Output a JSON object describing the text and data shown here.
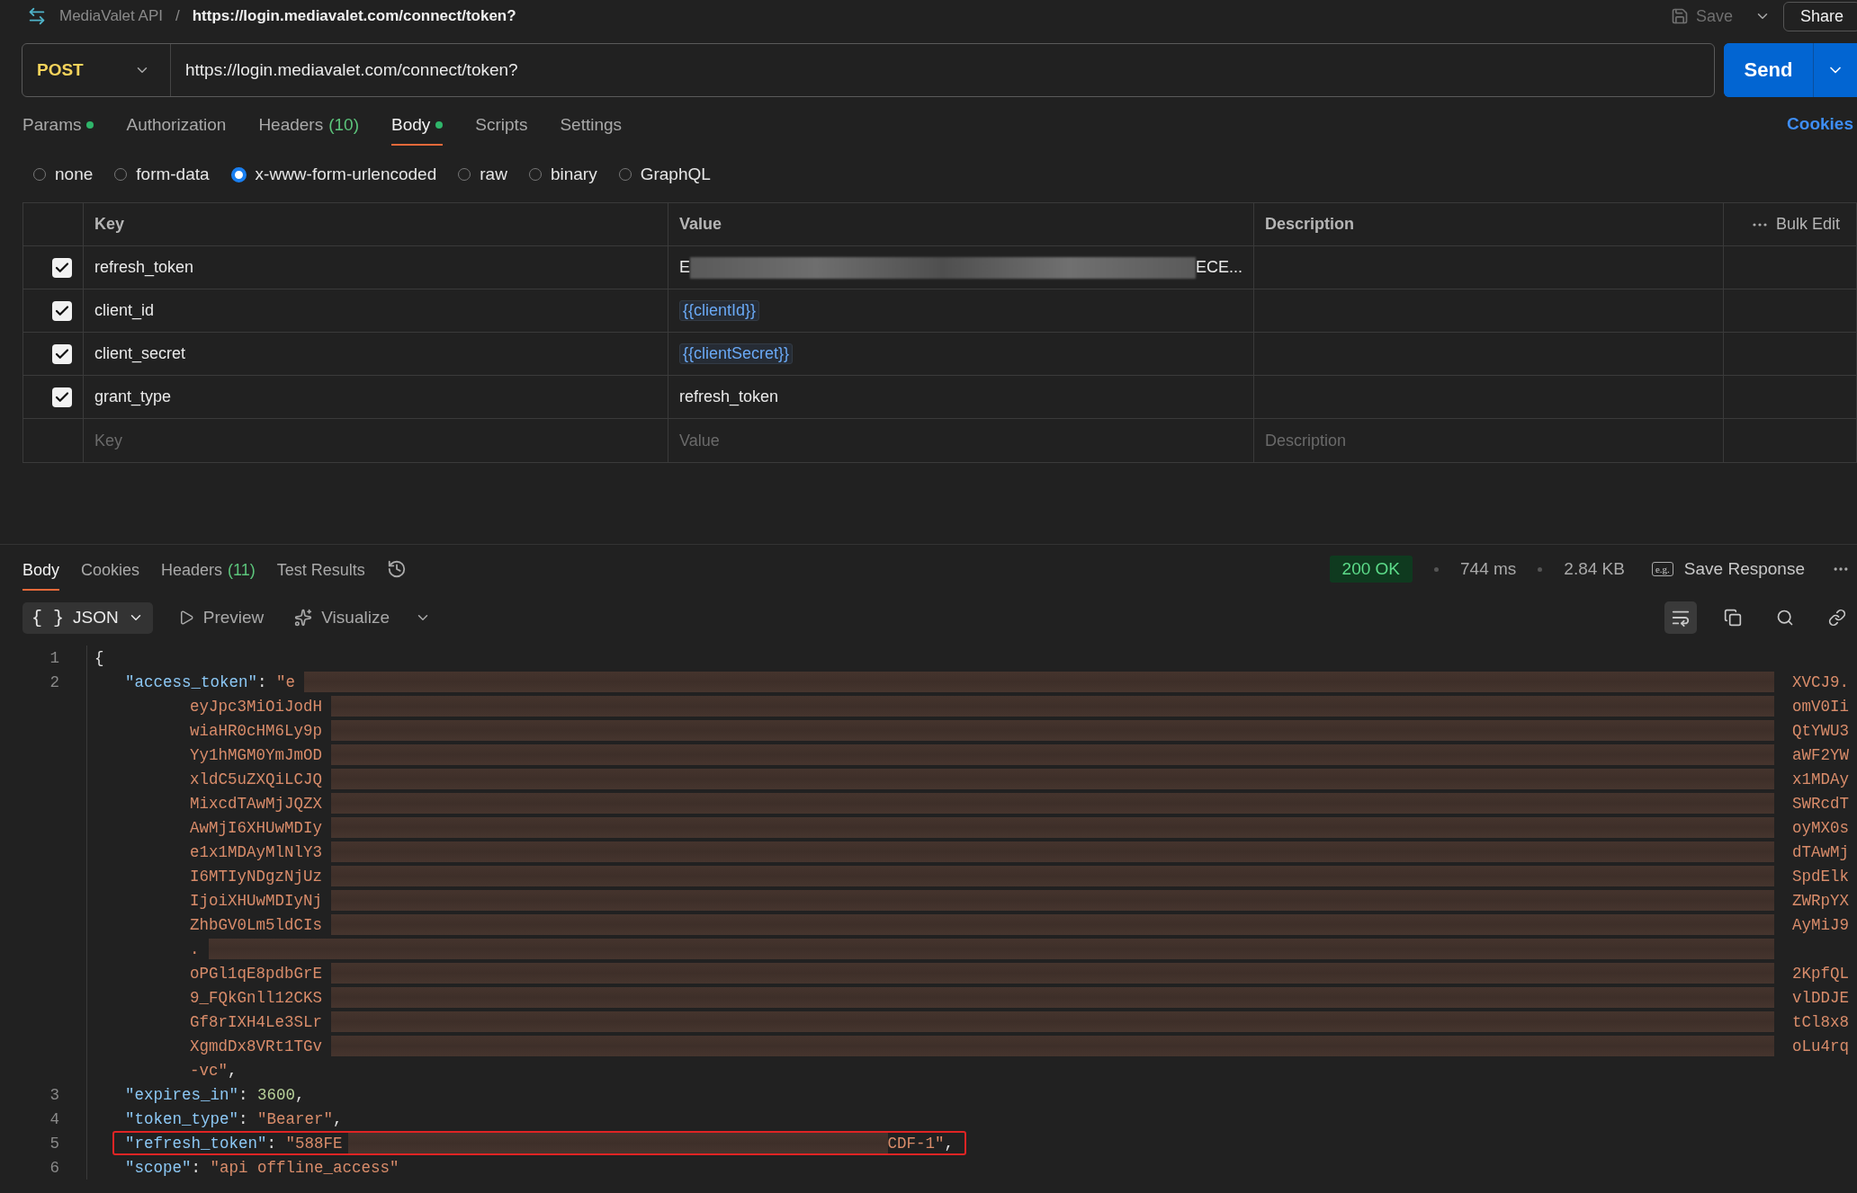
{
  "header": {
    "collection": "MediaValet API",
    "separator": "/",
    "request_name": "https://login.mediavalet.com/connect/token?",
    "save": "Save",
    "share": "Share"
  },
  "request": {
    "method": "POST",
    "url": "https://login.mediavalet.com/connect/token?",
    "send": "Send"
  },
  "request_tabs": [
    {
      "label": "Params",
      "dot": true,
      "selected": false
    },
    {
      "label": "Authorization",
      "dot": false,
      "selected": false
    },
    {
      "label": "Headers",
      "count": "(10)",
      "dot": false,
      "selected": false
    },
    {
      "label": "Body",
      "dot": true,
      "selected": true
    },
    {
      "label": "Scripts",
      "dot": false,
      "selected": false
    },
    {
      "label": "Settings",
      "dot": false,
      "selected": false
    }
  ],
  "cookies_link": "Cookies",
  "body_types": [
    {
      "label": "none",
      "selected": false
    },
    {
      "label": "form-data",
      "selected": false
    },
    {
      "label": "x-www-form-urlencoded",
      "selected": true
    },
    {
      "label": "raw",
      "selected": false
    },
    {
      "label": "binary",
      "selected": false
    },
    {
      "label": "GraphQL",
      "selected": false
    }
  ],
  "params_table": {
    "columns": [
      "Key",
      "Value",
      "Description"
    ],
    "bulk_edit": "Bulk Edit",
    "rows": [
      {
        "checked": true,
        "key": "refresh_token",
        "value": {
          "kind": "redacted",
          "start": "E",
          "end": "ECE..."
        }
      },
      {
        "checked": true,
        "key": "client_id",
        "value": {
          "kind": "variable",
          "text": "{{clientId}}"
        }
      },
      {
        "checked": true,
        "key": "client_secret",
        "value": {
          "kind": "variable",
          "text": "{{clientSecret}}"
        }
      },
      {
        "checked": true,
        "key": "grant_type",
        "value": {
          "kind": "text",
          "text": "refresh_token"
        }
      }
    ],
    "placeholders": {
      "key": "Key",
      "value": "Value",
      "description": "Description"
    }
  },
  "response": {
    "tabs": [
      {
        "label": "Body",
        "selected": true
      },
      {
        "label": "Cookies",
        "selected": false
      },
      {
        "label": "Headers",
        "count": "(11)",
        "selected": false
      },
      {
        "label": "Test Results",
        "selected": false
      }
    ],
    "status": "200 OK",
    "time": "744 ms",
    "size": "2.84 KB",
    "save_icon_text": "e.g.",
    "save_response": "Save Response",
    "format": "JSON",
    "format_icon": "{ }",
    "preview": "Preview",
    "visualize": "Visualize",
    "wrap_selected": true,
    "lines": [
      {
        "number": "1",
        "kind": "brace",
        "tokens": [
          {
            "kind": "punct",
            "text": "{"
          }
        ]
      },
      {
        "number": "2",
        "kind": "property",
        "redacted": true,
        "tokens": [
          {
            "kind": "key",
            "text": "\"access_token\""
          },
          {
            "kind": "punct",
            "text": ": "
          },
          {
            "kind": "string",
            "text": "\"e"
          }
        ],
        "tail": "XVCJ9."
      },
      {
        "kind": "wrap",
        "redacted": true,
        "tokens": [
          {
            "kind": "string",
            "text": "eyJpc3MiOiJodH"
          }
        ],
        "tail": "omV0Ii"
      },
      {
        "kind": "wrap",
        "redacted": true,
        "tokens": [
          {
            "kind": "string",
            "text": "wiaHR0cHM6Ly9p"
          }
        ],
        "tail": "QtYWU3"
      },
      {
        "kind": "wrap",
        "redacted": true,
        "tokens": [
          {
            "kind": "string",
            "text": "Yy1hMGM0YmJmOD"
          }
        ],
        "tail": "aWF2YW"
      },
      {
        "kind": "wrap",
        "redacted": true,
        "tokens": [
          {
            "kind": "string",
            "text": "xldC5uZXQiLCJQ"
          }
        ],
        "tail": "x1MDAy"
      },
      {
        "kind": "wrap",
        "redacted": true,
        "tokens": [
          {
            "kind": "string",
            "text": "MixcdTAwMjJQZX"
          }
        ],
        "tail": "SWRcdT"
      },
      {
        "kind": "wrap",
        "redacted": true,
        "tokens": [
          {
            "kind": "string",
            "text": "AwMjI6XHUwMDIy"
          }
        ],
        "tail": "oyMX0s"
      },
      {
        "kind": "wrap",
        "redacted": true,
        "tokens": [
          {
            "kind": "string",
            "text": "e1x1MDAyMlNlY3"
          }
        ],
        "tail": "dTAwMj"
      },
      {
        "kind": "wrap",
        "redacted": true,
        "tokens": [
          {
            "kind": "string",
            "text": "I6MTIyNDgzNjUz"
          }
        ],
        "tail": "SpdElk"
      },
      {
        "kind": "wrap",
        "redacted": true,
        "tokens": [
          {
            "kind": "string",
            "text": "IjoiXHUwMDIyNj"
          }
        ],
        "tail": "ZWRpYX"
      },
      {
        "kind": "wrap",
        "redacted": true,
        "tokens": [
          {
            "kind": "string",
            "text": "ZhbGV0Lm5ldCIs"
          }
        ],
        "tail": "AyMiJ9"
      },
      {
        "kind": "wrap",
        "redacted": true,
        "tokens": [
          {
            "kind": "string",
            "text": "."
          }
        ]
      },
      {
        "kind": "wrap",
        "redacted": true,
        "tokens": [
          {
            "kind": "string",
            "text": "oPGl1qE8pdbGrE"
          }
        ],
        "tail": "2KpfQL"
      },
      {
        "kind": "wrap",
        "redacted": true,
        "tokens": [
          {
            "kind": "string",
            "text": "9_FQkGnll12CKS"
          }
        ],
        "tail": "vlDDJE"
      },
      {
        "kind": "wrap",
        "redacted": true,
        "tokens": [
          {
            "kind": "string",
            "text": "Gf8rIXH4Le3SLr"
          }
        ],
        "tail": "tCl8x8"
      },
      {
        "kind": "wrap",
        "redacted": true,
        "tokens": [
          {
            "kind": "string",
            "text": "XgmdDx8VRt1TGv"
          }
        ],
        "tail": "oLu4rq"
      },
      {
        "kind": "wrap",
        "tokens": [
          {
            "kind": "string",
            "text": "-vc\""
          },
          {
            "kind": "punct",
            "text": ","
          }
        ]
      },
      {
        "number": "3",
        "kind": "property",
        "tokens": [
          {
            "kind": "key",
            "text": "\"expires_in\""
          },
          {
            "kind": "punct",
            "text": ": "
          },
          {
            "kind": "number",
            "text": "3600"
          },
          {
            "kind": "punct",
            "text": ","
          }
        ]
      },
      {
        "number": "4",
        "kind": "property",
        "tokens": [
          {
            "kind": "key",
            "text": "\"token_type\""
          },
          {
            "kind": "punct",
            "text": ": "
          },
          {
            "kind": "string",
            "text": "\"Bearer\""
          },
          {
            "kind": "punct",
            "text": ","
          }
        ]
      },
      {
        "number": "5",
        "kind": "property",
        "outlined": true,
        "redacted": true,
        "tokens": [
          {
            "kind": "key",
            "text": "\"refresh_token\""
          },
          {
            "kind": "punct",
            "text": ": "
          },
          {
            "kind": "string",
            "text": "\"588FE"
          }
        ],
        "tail_tokens": [
          {
            "kind": "string",
            "text": "CDF-1\""
          },
          {
            "kind": "punct",
            "text": ","
          }
        ]
      },
      {
        "number": "6",
        "kind": "property",
        "tokens": [
          {
            "kind": "key",
            "text": "\"scope\""
          },
          {
            "kind": "punct",
            "text": ": "
          },
          {
            "kind": "string",
            "text": "\"api offline_access\""
          }
        ]
      }
    ]
  }
}
